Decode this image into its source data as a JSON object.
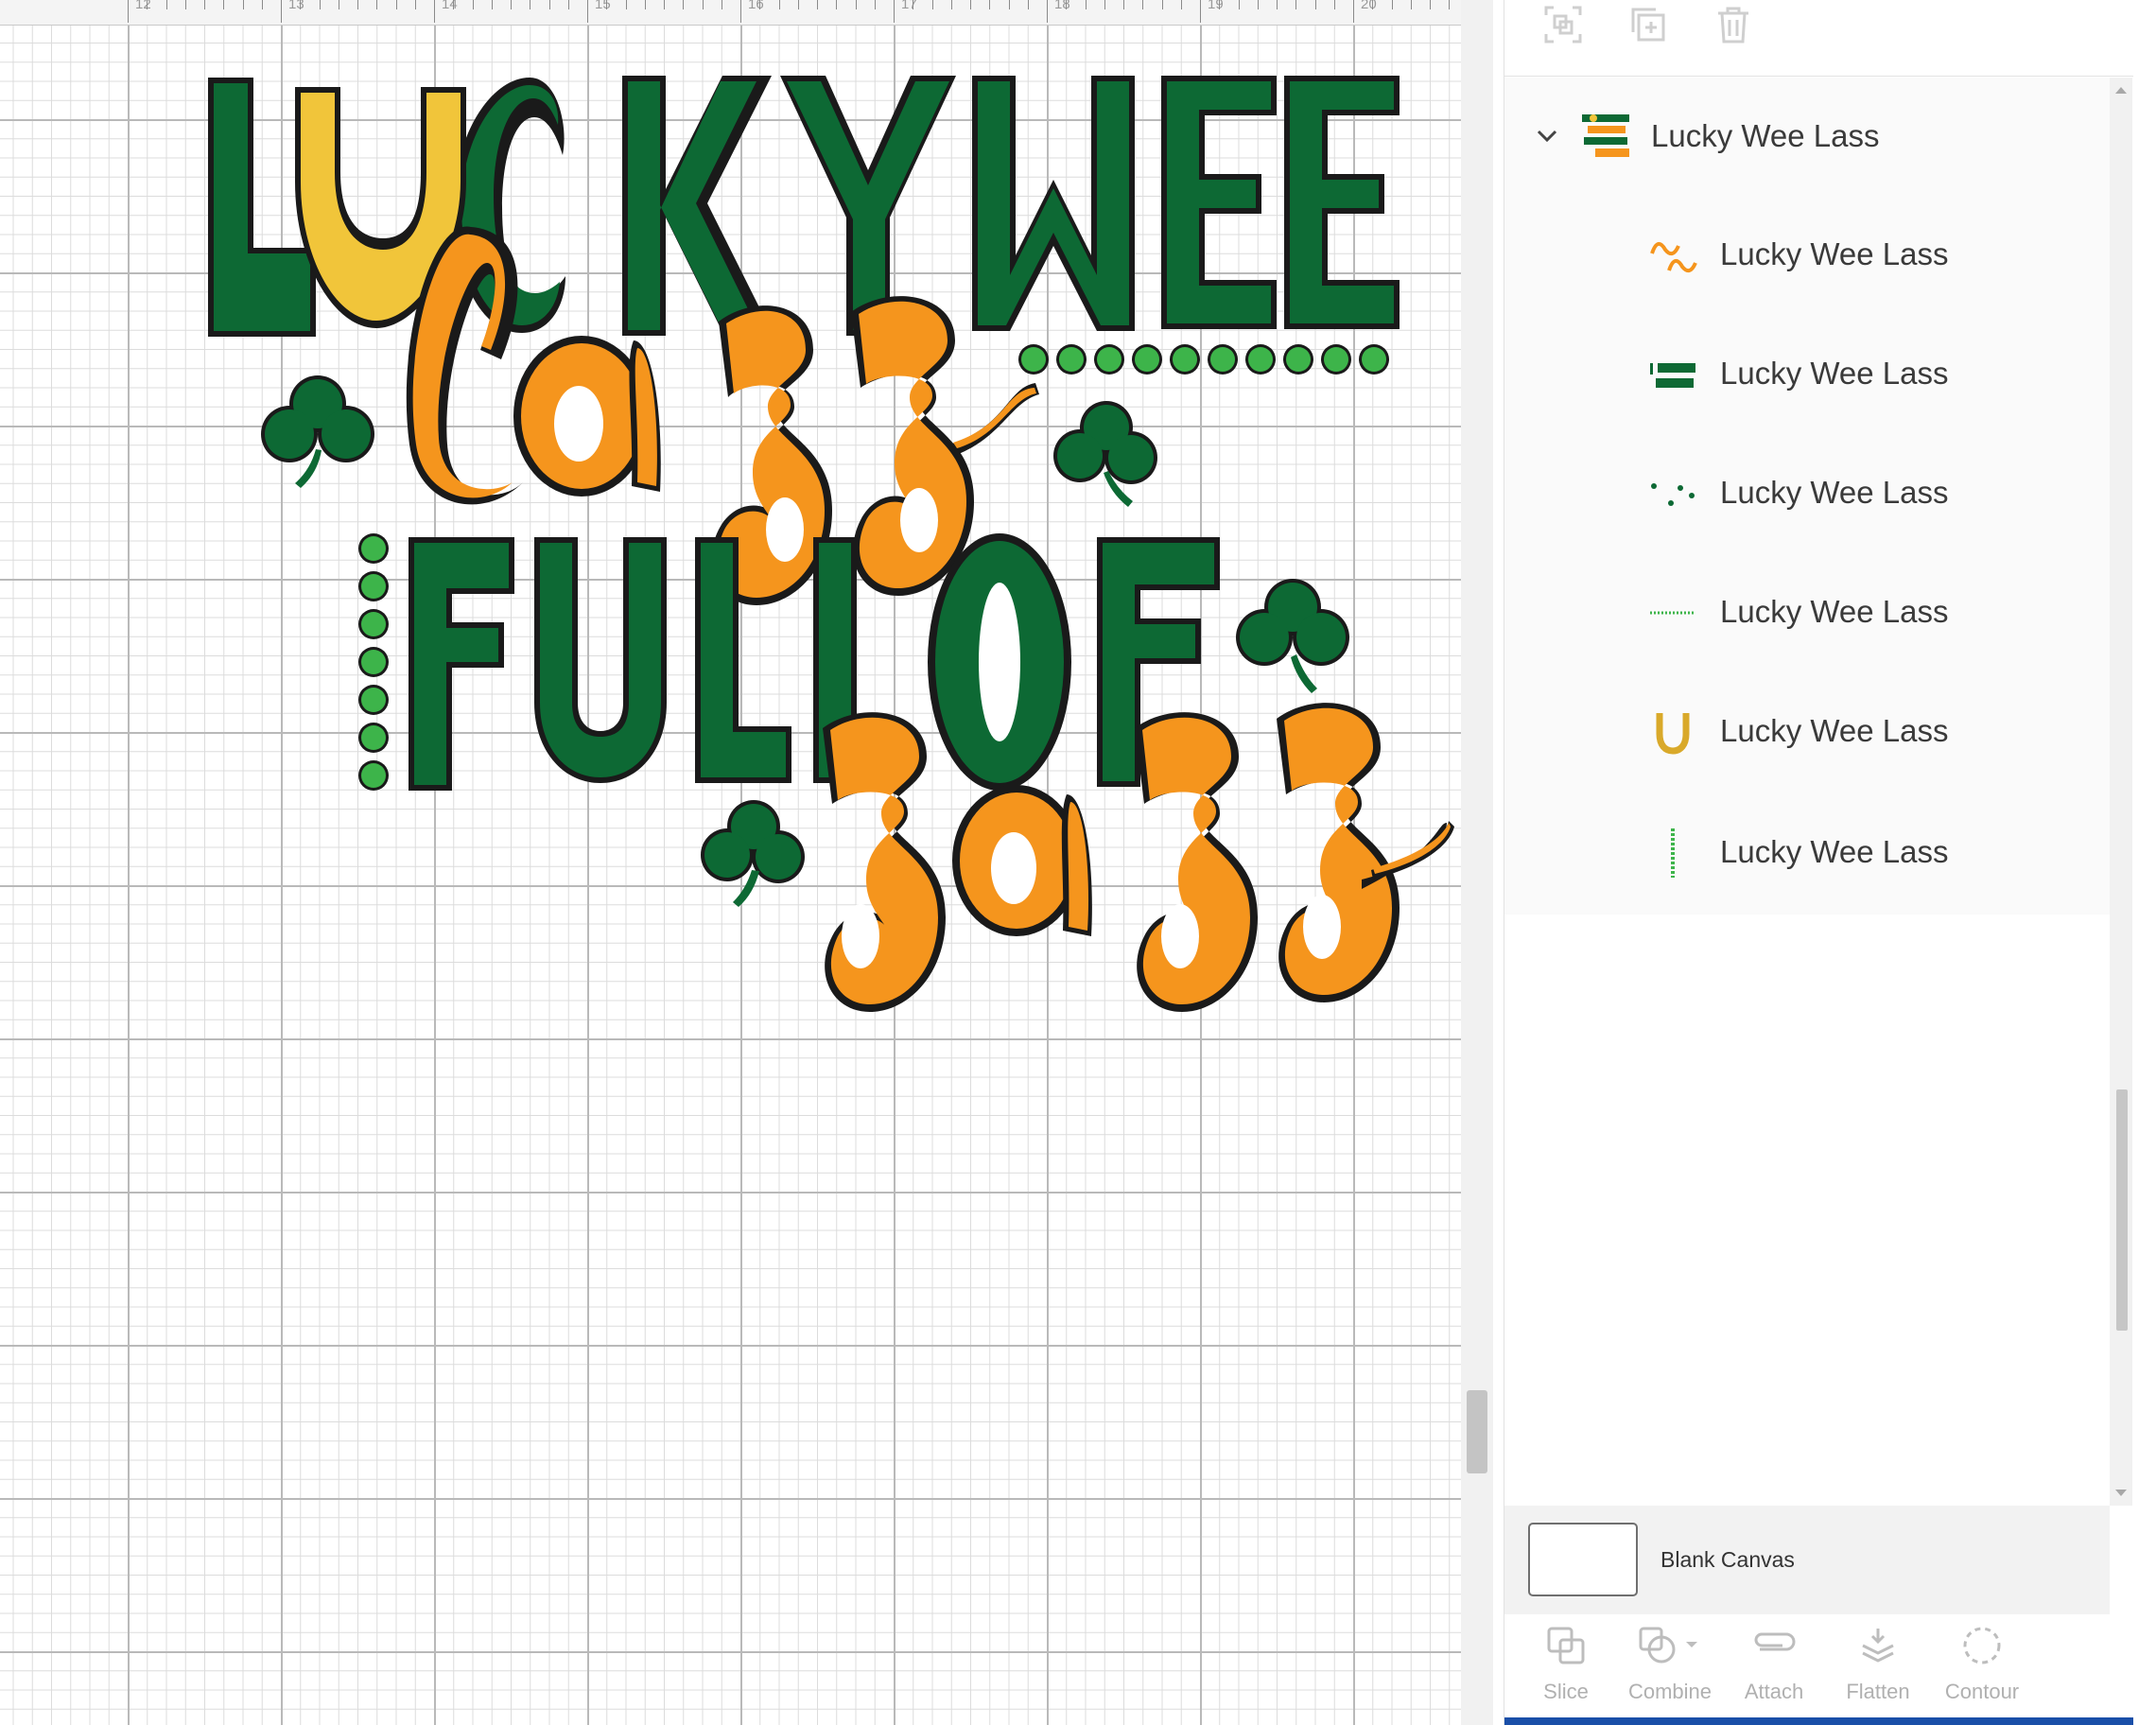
{
  "canvas": {
    "ruler_labels": [
      "12",
      "13",
      "14",
      "15",
      "16",
      "17",
      "18",
      "19",
      "20"
    ],
    "artwork": {
      "line1": "LUCKY WEE",
      "line2": "lass",
      "line3": "FULL OF",
      "line4": "sass",
      "colors": {
        "dark_green": "#0d6934",
        "orange": "#f5951d",
        "gold": "#f1c53a",
        "light_green": "#3db44a",
        "outline": "#1a1a1a"
      }
    }
  },
  "layers_panel": {
    "toolbar_icons": [
      "group-icon",
      "duplicate-icon",
      "delete-icon"
    ],
    "group": {
      "name": "Lucky Wee Lass",
      "expanded": true,
      "children": [
        {
          "name": "Lucky Wee Lass",
          "thumb": "orange-lettering-icon"
        },
        {
          "name": "Lucky Wee Lass",
          "thumb": "green-lettering-icon"
        },
        {
          "name": "Lucky Wee Lass",
          "thumb": "shamrock-dots-icon"
        },
        {
          "name": "Lucky Wee Lass",
          "thumb": "dot-row-icon"
        },
        {
          "name": "Lucky Wee Lass",
          "thumb": "horseshoe-icon"
        },
        {
          "name": "Lucky Wee Lass",
          "thumb": "dot-column-icon"
        }
      ]
    },
    "blank_canvas": {
      "label": "Blank Canvas"
    },
    "actions": [
      {
        "label": "Slice",
        "icon": "slice-icon"
      },
      {
        "label": "Combine",
        "icon": "combine-icon"
      },
      {
        "label": "Attach",
        "icon": "attach-icon"
      },
      {
        "label": "Flatten",
        "icon": "flatten-icon"
      },
      {
        "label": "Contour",
        "icon": "contour-icon"
      }
    ]
  }
}
